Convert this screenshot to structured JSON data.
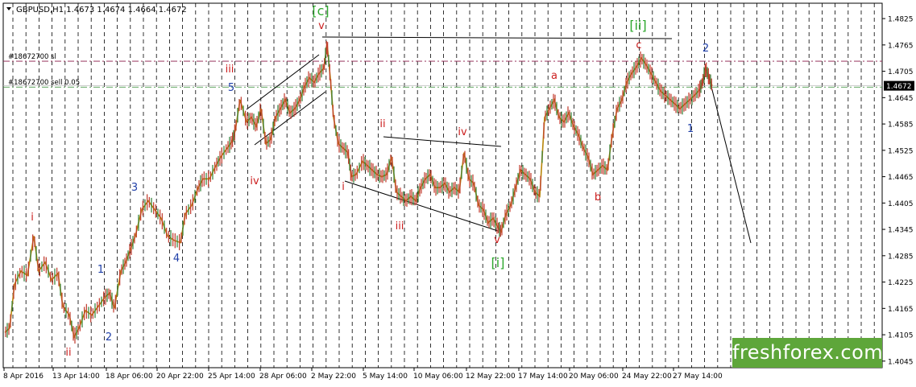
{
  "chart_data": {
    "type": "line",
    "title": "GBPUSD,H1  1.4673 1.4674 1.4664 1.4672",
    "ylim": [
      1.403,
      1.486
    ],
    "y_ticks": [
      "1.4825",
      "1.4765",
      "1.4705",
      "1.4645",
      "1.4585",
      "1.4525",
      "1.4465",
      "1.4405",
      "1.4345",
      "1.4285",
      "1.4225",
      "1.4165",
      "1.4105",
      "1.4045"
    ],
    "x_ticks": [
      "8 Apr 2016",
      "13 Apr 14:00",
      "18 Apr 06:00",
      "20 Apr 22:00",
      "25 Apr 14:00",
      "28 Apr 06:00",
      "2 May 22:00",
      "5 May 14:00",
      "10 May 06:00",
      "12 May 22:00",
      "17 May 14:00",
      "20 May 06:00",
      "24 May 22:00",
      "27 May 14:00"
    ],
    "current_price": "1.4672",
    "price_series": {
      "name": "GBPUSD H1",
      "color": "#b8860b",
      "x": [
        0,
        6,
        12,
        20,
        28,
        36,
        42,
        50,
        58,
        66,
        72,
        80,
        86,
        92,
        100,
        108,
        116,
        124,
        130,
        136,
        144,
        150,
        156,
        162,
        170,
        178,
        186,
        194,
        202,
        210,
        218,
        224,
        232,
        240,
        246,
        254,
        262,
        268,
        276,
        282,
        286,
        292,
        300,
        306,
        312,
        318,
        324,
        330,
        336,
        342,
        348,
        354,
        360,
        366,
        372,
        378,
        384,
        390,
        396,
        400,
        404,
        408,
        414,
        420,
        426,
        430,
        436,
        444,
        450,
        456,
        462,
        468,
        474,
        480,
        486,
        492,
        498,
        504,
        510,
        516,
        522,
        528,
        534,
        540,
        546,
        552,
        558,
        564,
        570,
        576,
        582,
        588,
        594,
        600,
        606,
        612,
        616,
        622,
        628,
        634,
        640,
        646,
        652,
        658,
        664,
        670,
        676,
        682,
        688,
        694,
        700,
        706,
        712,
        718,
        724,
        730,
        736,
        742,
        748,
        754,
        760,
        766,
        772,
        778,
        784,
        790,
        796,
        802,
        808,
        814,
        820,
        826,
        832,
        838,
        844,
        850,
        856,
        862,
        866,
        870,
        874,
        878
      ],
      "values": [
        1.411,
        1.412,
        1.422,
        1.425,
        1.424,
        1.433,
        1.425,
        1.427,
        1.423,
        1.4245,
        1.417,
        1.415,
        1.41,
        1.412,
        1.416,
        1.415,
        1.417,
        1.419,
        1.42,
        1.4165,
        1.425,
        1.427,
        1.43,
        1.433,
        1.439,
        1.441,
        1.439,
        1.437,
        1.433,
        1.432,
        1.4315,
        1.438,
        1.44,
        1.444,
        1.446,
        1.446,
        1.449,
        1.451,
        1.453,
        1.4545,
        1.457,
        1.464,
        1.459,
        1.46,
        1.458,
        1.462,
        1.454,
        1.455,
        1.46,
        1.462,
        1.464,
        1.461,
        1.462,
        1.464,
        1.467,
        1.469,
        1.468,
        1.47,
        1.4712,
        1.4768,
        1.469,
        1.46,
        1.454,
        1.453,
        1.452,
        1.4465,
        1.447,
        1.45,
        1.449,
        1.448,
        1.447,
        1.4465,
        1.447,
        1.451,
        1.443,
        1.442,
        1.441,
        1.442,
        1.441,
        1.444,
        1.446,
        1.447,
        1.444,
        1.444,
        1.445,
        1.443,
        1.444,
        1.443,
        1.452,
        1.446,
        1.445,
        1.44,
        1.439,
        1.436,
        1.437,
        1.435,
        1.434,
        1.438,
        1.44,
        1.444,
        1.448,
        1.447,
        1.446,
        1.443,
        1.442,
        1.46,
        1.462,
        1.464,
        1.46,
        1.459,
        1.461,
        1.458,
        1.456,
        1.453,
        1.451,
        1.447,
        1.448,
        1.449,
        1.448,
        1.456,
        1.462,
        1.464,
        1.468,
        1.47,
        1.4715,
        1.4735,
        1.472,
        1.47,
        1.468,
        1.466,
        1.465,
        1.464,
        1.463,
        1.462,
        1.463,
        1.464,
        1.465,
        1.4662,
        1.468,
        1.4712,
        1.469,
        1.4672
      ]
    },
    "horizontal_lines": [
      {
        "label": "#18672700 sl",
        "value": 1.4728,
        "color": "#8b1a4a",
        "style": "dashdot"
      },
      {
        "label": "#18672700 sell 0.05",
        "value": 1.4669,
        "color": "#2e8b2e",
        "style": "dashdot"
      }
    ],
    "wave_labels_red": [
      "i",
      "ii",
      "iii",
      "iv",
      "v",
      "i",
      "ii",
      "iii",
      "iv",
      "v",
      "a",
      "b",
      "c"
    ],
    "wave_labels_blue": [
      "1",
      "2",
      "3",
      "4",
      "5",
      "1",
      "2"
    ],
    "wave_labels_green": [
      "[c]",
      "[i]",
      "[ii]"
    ],
    "watermark": "freshforex.com"
  }
}
